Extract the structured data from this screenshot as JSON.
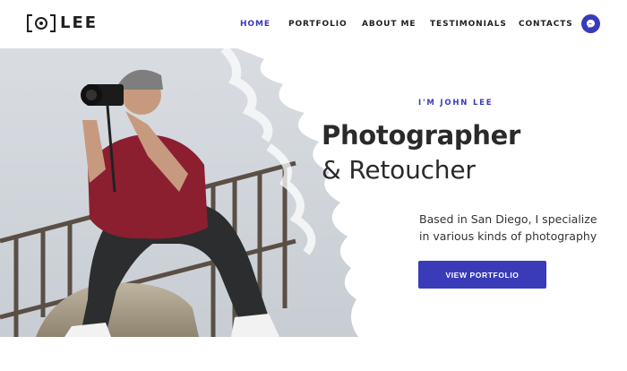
{
  "brand": {
    "logo_text": "LEE"
  },
  "nav": {
    "items": [
      {
        "label": "HOME",
        "active": true
      },
      {
        "label": "PORTFOLIO",
        "active": false
      },
      {
        "label": "ABOUT ME",
        "active": false
      },
      {
        "label": "TESTIMONIALS",
        "active": false
      },
      {
        "label": "CONTACTS",
        "active": false
      }
    ],
    "message_icon": "messenger-icon"
  },
  "hero": {
    "eyebrow": "I'M JOHN LEE",
    "title_line1": "Photographer",
    "title_line2": "& Retoucher",
    "description": "Based in San Diego, I specialize in various kinds of photography",
    "cta_label": "VIEW PORTFOLIO"
  },
  "colors": {
    "accent": "#3a3bb8",
    "text": "#2a2a2a",
    "background": "#ffffff"
  }
}
